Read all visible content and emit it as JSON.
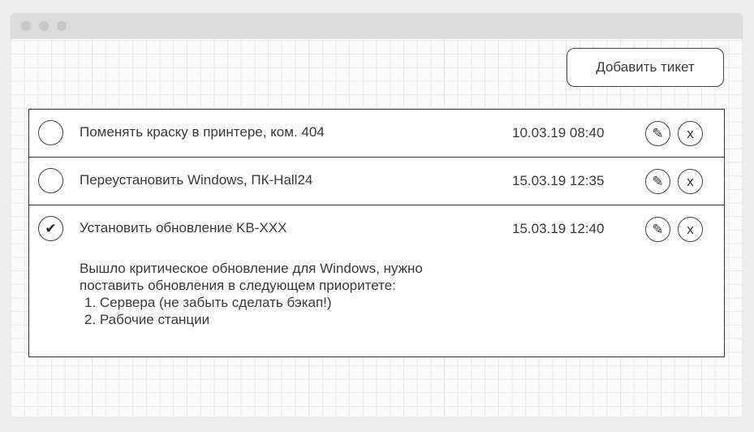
{
  "toolbar": {
    "add_ticket_label": "Добавить тикет"
  },
  "tickets": [
    {
      "done_mark": "",
      "title": "Поменять краску в принтере, ком. 404",
      "date": "10.03.19 08:40",
      "edit_icon": "✎",
      "delete_icon": "x"
    },
    {
      "done_mark": "",
      "title": "Переустановить Windows, ПК-Hall24",
      "date": "15.03.19 12:35",
      "edit_icon": "✎",
      "delete_icon": "x"
    },
    {
      "done_mark": "✔",
      "title": "Установить обновление KB-XXX",
      "date": "15.03.19 12:40",
      "edit_icon": "✎",
      "delete_icon": "x",
      "description": {
        "line1": "Вышло критическое обновление для Windows, нужно",
        "line2": "поставить обновления в следующем приоритете:",
        "items": [
          "1. Сервера (не забыть сделать бэкап!)",
          "2. Рабочие станции"
        ]
      }
    }
  ],
  "icons": {
    "edit": "pencil-icon",
    "delete": "close-icon",
    "done": "checkmark-icon"
  }
}
